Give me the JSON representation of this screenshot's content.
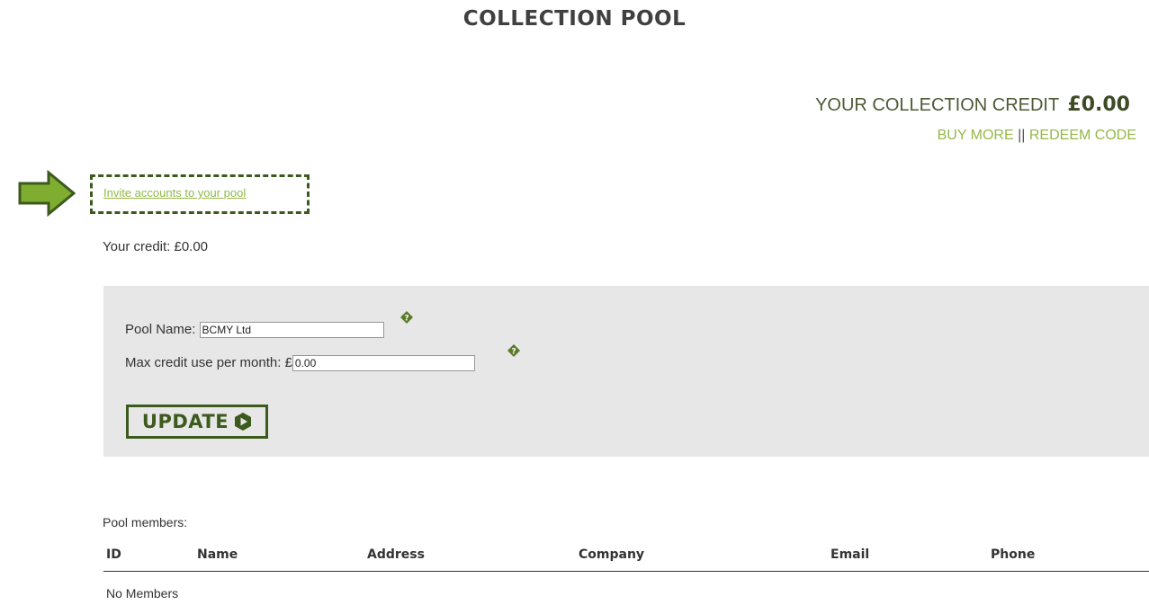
{
  "page": {
    "title": "COLLECTION POOL"
  },
  "credit": {
    "label": "YOUR COLLECTION CREDIT",
    "amount": "£0.00",
    "buy_more": "BUY MORE",
    "separator": "||",
    "redeem": "REDEEM CODE"
  },
  "invite": {
    "link_text": "Invite accounts to your pool"
  },
  "your_credit": "Your credit: £0.00",
  "form": {
    "pool_name_label": "Pool Name:",
    "pool_name_value": "BCMY Ltd",
    "max_credit_label": "Max credit use per month: £",
    "max_credit_value": "0.00",
    "help_glyph": "?",
    "update_label": "UPDATE"
  },
  "members": {
    "label": "Pool members:",
    "columns": [
      "ID",
      "Name",
      "Address",
      "Company",
      "Email",
      "Phone"
    ],
    "empty_text": "No Members"
  },
  "colors": {
    "accent_light": "#94b84a",
    "accent_dark": "#3d5a1e",
    "panel_bg": "#e6e7e6"
  },
  "icons": {
    "arrow": "right-arrow-icon",
    "help": "help-diamond-icon",
    "update": "play-hexagon-icon"
  }
}
